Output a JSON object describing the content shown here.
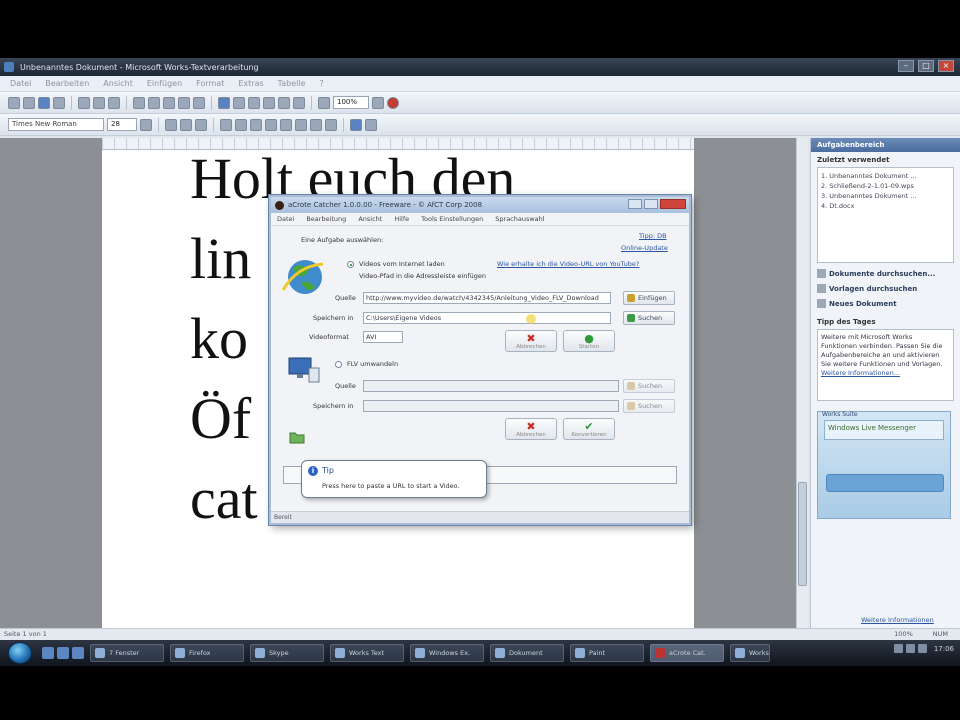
{
  "window": {
    "title": "Unbenanntes Dokument - Microsoft Works-Textverarbeitung",
    "min_btn": "–",
    "max_btn": "□",
    "close_btn": "×"
  },
  "menu": [
    "Datei",
    "Bearbeiten",
    "Ansicht",
    "Einfügen",
    "Format",
    "Extras",
    "Tabelle",
    "?"
  ],
  "toolbar": {
    "zoom": "100%",
    "font_name": "Times New Roman",
    "font_size": "28"
  },
  "document": {
    "lines": [
      "Holt euch den",
      "lin",
      "ko",
      "Öf",
      "cat"
    ]
  },
  "taskpane": {
    "header": "Aufgabenbereich",
    "recent_header": "Zuletzt verwendet",
    "recent_items": [
      "1. Unbenanntes Dokument ...",
      "2. Schließend-2-1.01-09.wps",
      "3. Unbenanntes Dokument ...",
      "4. Dt.docx"
    ],
    "links": [
      "Dokumente durchsuchen...",
      "Vorlagen durchsuchen",
      "Neues Dokument"
    ],
    "tip_header": "Tipp des Tages",
    "tip_text": "Weitere mit Microsoft Works Funktionen verbinden. Passen Sie die Aufgabenbereiche an und aktivieren Sie weitere Funktionen und Vorlagen.",
    "tip_link": "Weitere Informationen...",
    "promo_title": "Works Suite",
    "promo_label": "Windows Live Messenger",
    "footer_link": "Weitere Informationen"
  },
  "statusbar": {
    "left": "Seite 1 von 1",
    "zoom": "100%",
    "ovr": "NUM"
  },
  "dialog": {
    "title": "aCrote Catcher 1.0.0.00 - Freeware - © AfCT Corp 2008",
    "menu": [
      "Datei",
      "Bearbeitung",
      "Ansicht",
      "Hilfe",
      "Tools Einstellungen",
      "Sprachauswahl"
    ],
    "top_links": [
      "Tipp: DB",
      "Online-Update"
    ],
    "intro": "Eine Aufgabe auswählen:",
    "option1": "Videos vom Internet laden",
    "option1_link": "Wie erhalte ich die Video-URL von YouTube?",
    "option1_sub": "Video-Pfad in die Adressleiste einfügen",
    "source_label": "Quelle",
    "source_value": "http://www.myvideo.de/watch/4342345/Anleitung_Video_FLV_Download",
    "paste_btn": "Einfügen",
    "target_label": "Speichern in",
    "target_value": "C:\\Users\\Eigene Videos",
    "search_btn": "Suchen",
    "format_label": "Videoformat",
    "format_value": "AVI",
    "cancel_label": "Abbrechen",
    "start_label": "Starten",
    "option2": "FLV umwandeln",
    "source2_label": "Quelle",
    "target2_label": "Speichern in",
    "search2_btn": "Suchen",
    "search3_btn": "Suchen",
    "cancel2_label": "Abbrechen",
    "convert_label": "Konvertieren",
    "tooltip_title": "Tip",
    "tooltip_text": "Press here to paste a URL to start a Video.",
    "status": "Bereit"
  },
  "taskbar": {
    "tasks": [
      "7 Fenster",
      "Firefox",
      "Skype",
      "Works Text",
      "Windows Ex.",
      "Dokument",
      "Paint",
      "aCrote Cat.",
      "Works"
    ],
    "time": "17:06"
  }
}
